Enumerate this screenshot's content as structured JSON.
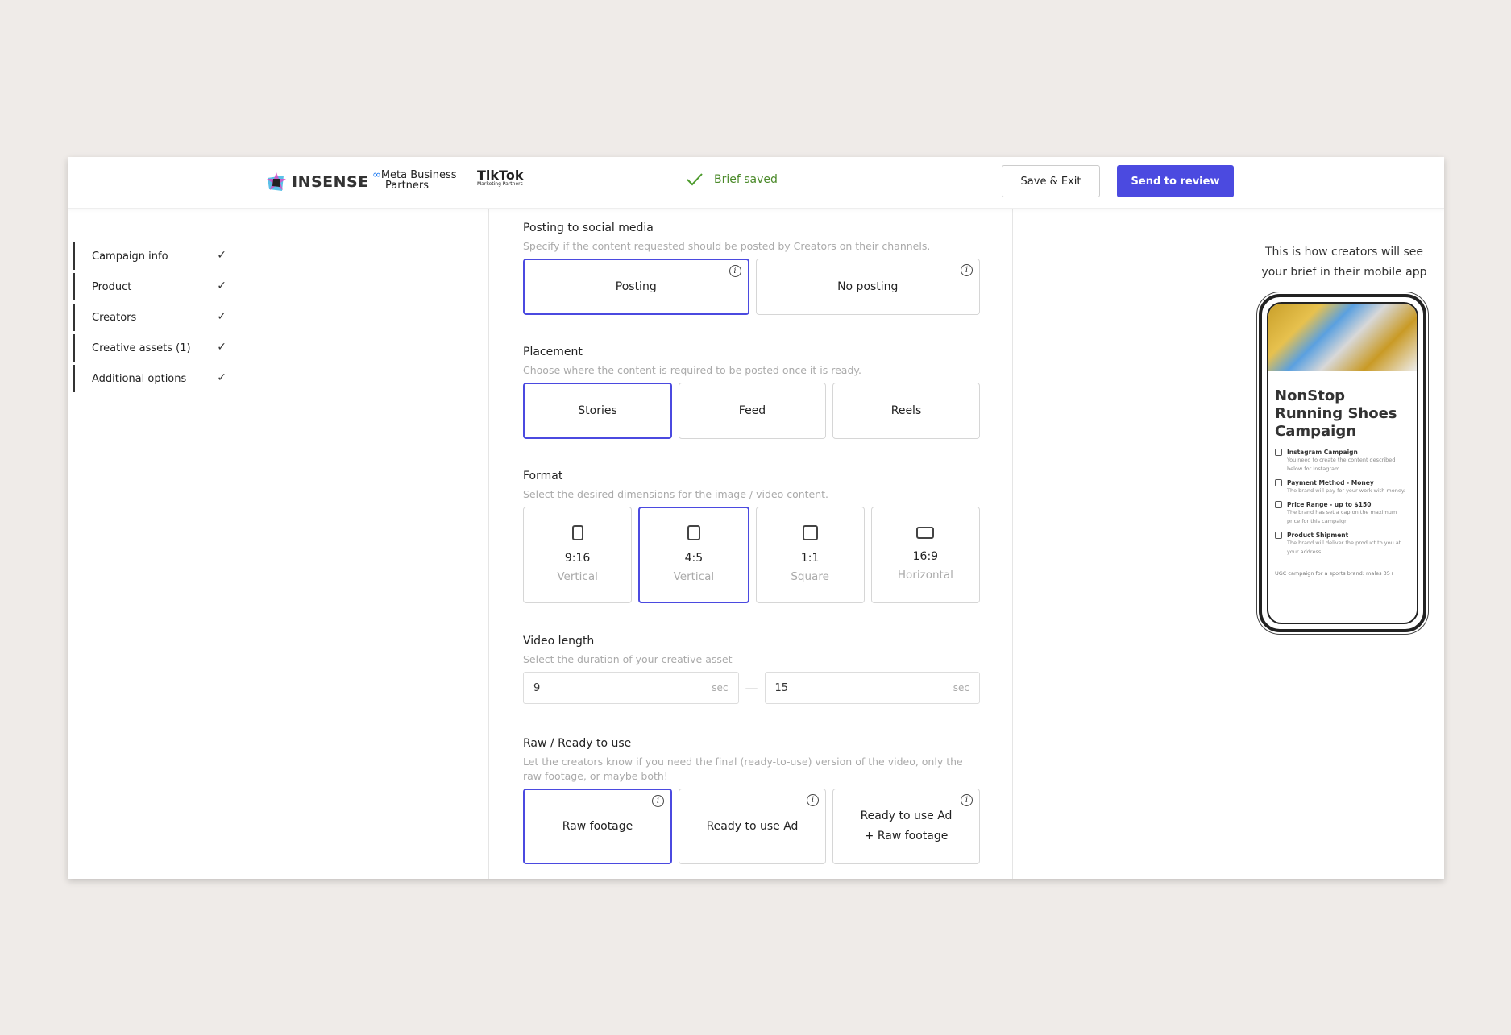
{
  "header": {
    "brand": "INSENSE",
    "meta_line1": "Meta Business",
    "meta_line2": "Partners",
    "tiktok": "TikTok",
    "tiktok_sub": "Marketing Partners",
    "status": "Brief saved",
    "save_exit": "Save & Exit",
    "send_review": "Send to review"
  },
  "colors": {
    "accent": "#4b4ae0",
    "success": "#4b8a2a",
    "background": "#efebe8"
  },
  "sidebar": {
    "items": [
      {
        "label": "Campaign info",
        "done": true
      },
      {
        "label": "Product",
        "done": true
      },
      {
        "label": "Creators",
        "done": true
      },
      {
        "label": "Creative assets (1)",
        "done": true
      },
      {
        "label": "Additional options",
        "done": true
      }
    ],
    "check": "✓"
  },
  "posting": {
    "title": "Posting to social media",
    "desc": "Specify if the content requested should be posted by Creators on their channels.",
    "options": [
      "Posting",
      "No posting"
    ],
    "selected": "Posting"
  },
  "placement": {
    "title": "Placement",
    "desc": "Choose where the content is required to be posted once it is ready.",
    "options": [
      "Stories",
      "Feed",
      "Reels"
    ],
    "selected": "Stories"
  },
  "format": {
    "title": "Format",
    "desc": "Select the desired dimensions for the image / video content.",
    "options": [
      {
        "ratio": "9:16",
        "label": "Vertical"
      },
      {
        "ratio": "4:5",
        "label": "Vertical"
      },
      {
        "ratio": "1:1",
        "label": "Square"
      },
      {
        "ratio": "16:9",
        "label": "Horizontal"
      }
    ],
    "selected": "4:5"
  },
  "video_length": {
    "title": "Video length",
    "desc": "Select the duration of your creative asset",
    "min": "9",
    "max": "15",
    "unit": "sec",
    "separator": "—"
  },
  "raw": {
    "title": "Raw / Ready to use",
    "desc": "Let the creators know if you need the final (ready-to-use) version of the video, only the raw footage, or maybe both!",
    "options": [
      "Raw footage",
      "Ready to use Ad",
      "Ready to use Ad + Raw footage"
    ],
    "selected": "Raw footage"
  },
  "preview": {
    "caption": "This is how creators will see your brief in their mobile app",
    "title": "NonStop Running Shoes Campaign",
    "items": [
      {
        "title": "Instagram Campaign",
        "text": "You need to create the content described below for Instagram"
      },
      {
        "title": "Payment Method - Money",
        "text": "The brand will pay for your work with money."
      },
      {
        "title": "Price Range - up to $150",
        "text": "The brand has set a cap on the maximum price for this campaign"
      },
      {
        "title": "Product Shipment",
        "text": "The brand will deliver the product to you at your address."
      }
    ],
    "footer": "UGC campaign for a sports brand: males 35+"
  },
  "info_glyph": "i"
}
